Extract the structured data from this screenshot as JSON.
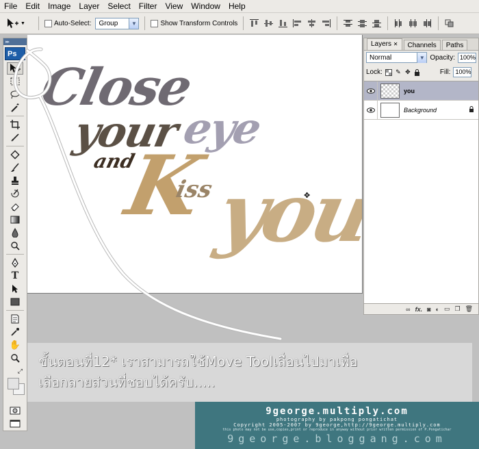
{
  "menu": [
    "File",
    "Edit",
    "Image",
    "Layer",
    "Select",
    "Filter",
    "View",
    "Window",
    "Help"
  ],
  "options": {
    "auto_select_label": "Auto-Select:",
    "auto_select_value": "Group",
    "show_transform_label": "Show Transform Controls"
  },
  "toolbox": {
    "logo": "Ps"
  },
  "canvas": {
    "words": {
      "close": "Close",
      "your": "your",
      "eye": "eye",
      "and": "and",
      "kiss_k": "K",
      "kiss": "iss",
      "you": "you"
    }
  },
  "layers_panel": {
    "tabs": [
      "Layers",
      "Channels",
      "Paths"
    ],
    "blend_mode": "Normal",
    "opacity_label": "Opacity:",
    "opacity_value": "100%",
    "lock_label": "Lock:",
    "fill_label": "Fill:",
    "fill_value": "100%",
    "layers": [
      {
        "name": "you",
        "selected": true
      },
      {
        "name": "Background",
        "selected": false,
        "locked": true
      }
    ],
    "footer_fx": "fx."
  },
  "caption": {
    "line1": "ขั้นตอนที่12* เราสามารถใช้Move Toolเลื่อนไปมาเพื่อ",
    "line2": "เลือกลายส่วนที่ชอบได้ครับ....."
  },
  "watermark": {
    "site": "9george.multiply.com",
    "photography": "photography by pakpong pongatichat",
    "copyright": "Copyright 2005-2007 by 9george,http://9george.multiply.com",
    "notice": "this photo may not be use,copies,print or reproduce in anyway without prior written permission of P.Pongatichar",
    "blog": "9george.bloggang.com"
  }
}
